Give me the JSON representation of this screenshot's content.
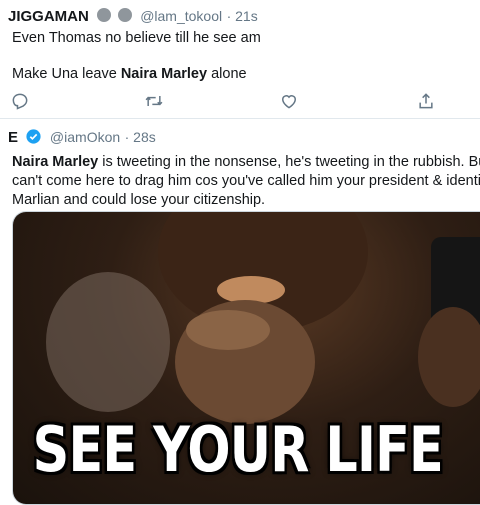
{
  "tweet1": {
    "display_name": "JIGGAMAN",
    "handle": "@lam_tokool",
    "time": "21s",
    "line1": "Even Thomas no believe till he see am",
    "line2_pre": "Make Una leave ",
    "line2_bold": "Naira Marley",
    "line2_post": " alone",
    "actions": [
      "reply-icon",
      "retweet-icon",
      "like-icon",
      "share-icon"
    ]
  },
  "tweet2": {
    "display_name": "E",
    "handle": "@iamOkon",
    "time": "28s",
    "bold_lead": "Naira Marley",
    "rest1": " is tweeting in the nonsense, he's tweeting in the rubbish. But y",
    "line2": "can't come here to drag him cos you've called him your president & identifie",
    "line3": "Marlian and could lose your citizenship.",
    "meme_caption": "SEE YOUR LIFE"
  },
  "colors": {
    "accent": "#1da1f2",
    "muted": "#657786",
    "divider": "#e1e8ed"
  }
}
